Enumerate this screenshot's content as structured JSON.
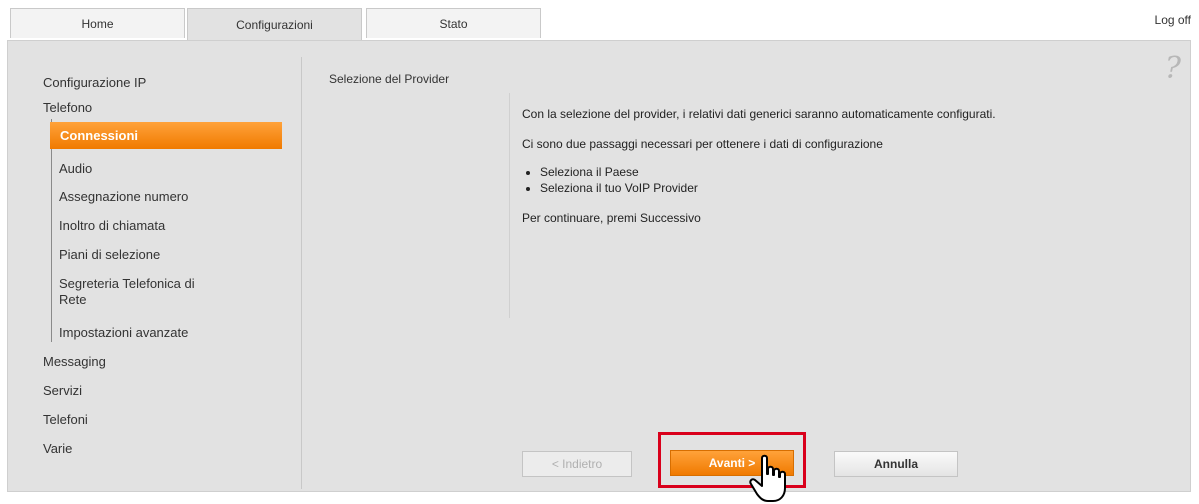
{
  "tabs": [
    {
      "label": "Home",
      "active": false
    },
    {
      "label": "Configurazioni",
      "active": true
    },
    {
      "label": "Stato",
      "active": false
    }
  ],
  "logoff_label": "Log off",
  "sidebar": {
    "items": [
      {
        "label": "Configurazione IP"
      },
      {
        "label": "Telefono"
      },
      {
        "label": "Connessioni",
        "active": true
      },
      {
        "label": "Audio"
      },
      {
        "label": "Assegnazione numero"
      },
      {
        "label": "Inoltro di chiamata"
      },
      {
        "label": "Piani di selezione"
      },
      {
        "label": "Segreteria Telefonica di"
      },
      {
        "label": "Rete"
      },
      {
        "label": "Impostazioni avanzate"
      },
      {
        "label": "Messaging"
      },
      {
        "label": "Servizi"
      },
      {
        "label": "Telefoni"
      },
      {
        "label": "Varie"
      }
    ]
  },
  "main": {
    "section_title": "Selezione del Provider",
    "intro": "Con la selezione del provider, i relativi dati generici saranno automaticamente configurati.",
    "steps_intro": "Ci sono due passaggi necessari per ottenere i dati di configurazione",
    "steps": [
      "Seleziona il Paese",
      "Seleziona il tuo VoIP Provider"
    ],
    "continue_text": "Per continuare, premi Successivo"
  },
  "buttons": {
    "back": "< Indietro",
    "next": "Avanti >",
    "cancel": "Annulla"
  },
  "icons": {
    "help": "help-icon",
    "cursor": "hand-pointer-icon"
  },
  "colors": {
    "accent": "#f58220",
    "highlight": "#d9001b"
  }
}
